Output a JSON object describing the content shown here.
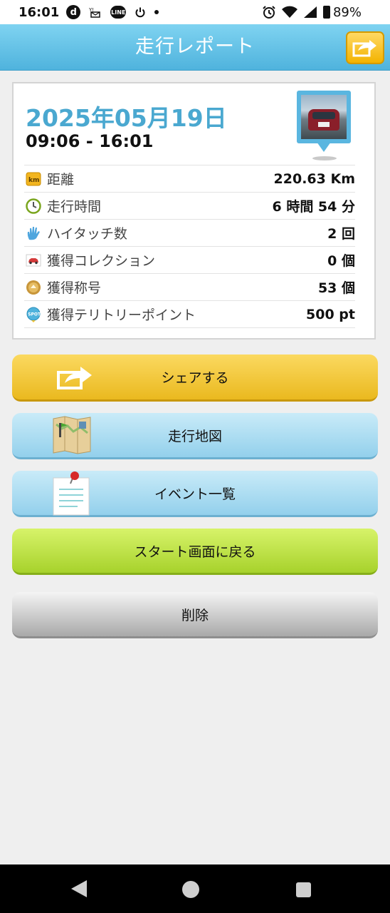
{
  "status_bar": {
    "time": "16:01",
    "battery": "89%",
    "left_icons": [
      "docomo-d-icon",
      "ymobile-mail-icon",
      "line-icon",
      "power-icon",
      "dot-icon"
    ],
    "right_icons": [
      "alarm-icon",
      "wifi-icon",
      "signal-icon",
      "battery-icon"
    ]
  },
  "header": {
    "title": "走行レポート",
    "share_icon": "share-arrow-icon"
  },
  "report": {
    "date": "2025年05月19日",
    "time_range": "09:06 - 16:01",
    "stats": [
      {
        "icon": "km-icon",
        "label": "距離",
        "value": "220.63 Km"
      },
      {
        "icon": "clock-icon",
        "label": "走行時間",
        "value": "6 時間 54 分"
      },
      {
        "icon": "high-five-icon",
        "label": "ハイタッチ数",
        "value": "2 回"
      },
      {
        "icon": "car-collection-icon",
        "label": "獲得コレクション",
        "value": "0 個"
      },
      {
        "icon": "medal-icon",
        "label": "獲得称号",
        "value": "53 個"
      },
      {
        "icon": "spot-icon",
        "label": "獲得テリトリーポイント",
        "value": "500 pt"
      }
    ]
  },
  "buttons": {
    "share": "シェアする",
    "map": "走行地図",
    "events": "イベント一覧",
    "start": "スタート画面に戻る",
    "delete": "削除"
  },
  "colors": {
    "header": "#4fb3dd",
    "date": "#4aa8d0",
    "share_button": "#eab91f",
    "blue_button": "#93d0ec",
    "green_button": "#a7d22c",
    "gray_button": "#a9a9a9"
  },
  "nav_bar": {
    "back": "back-icon",
    "home": "home-icon",
    "recent": "recent-apps-icon"
  }
}
